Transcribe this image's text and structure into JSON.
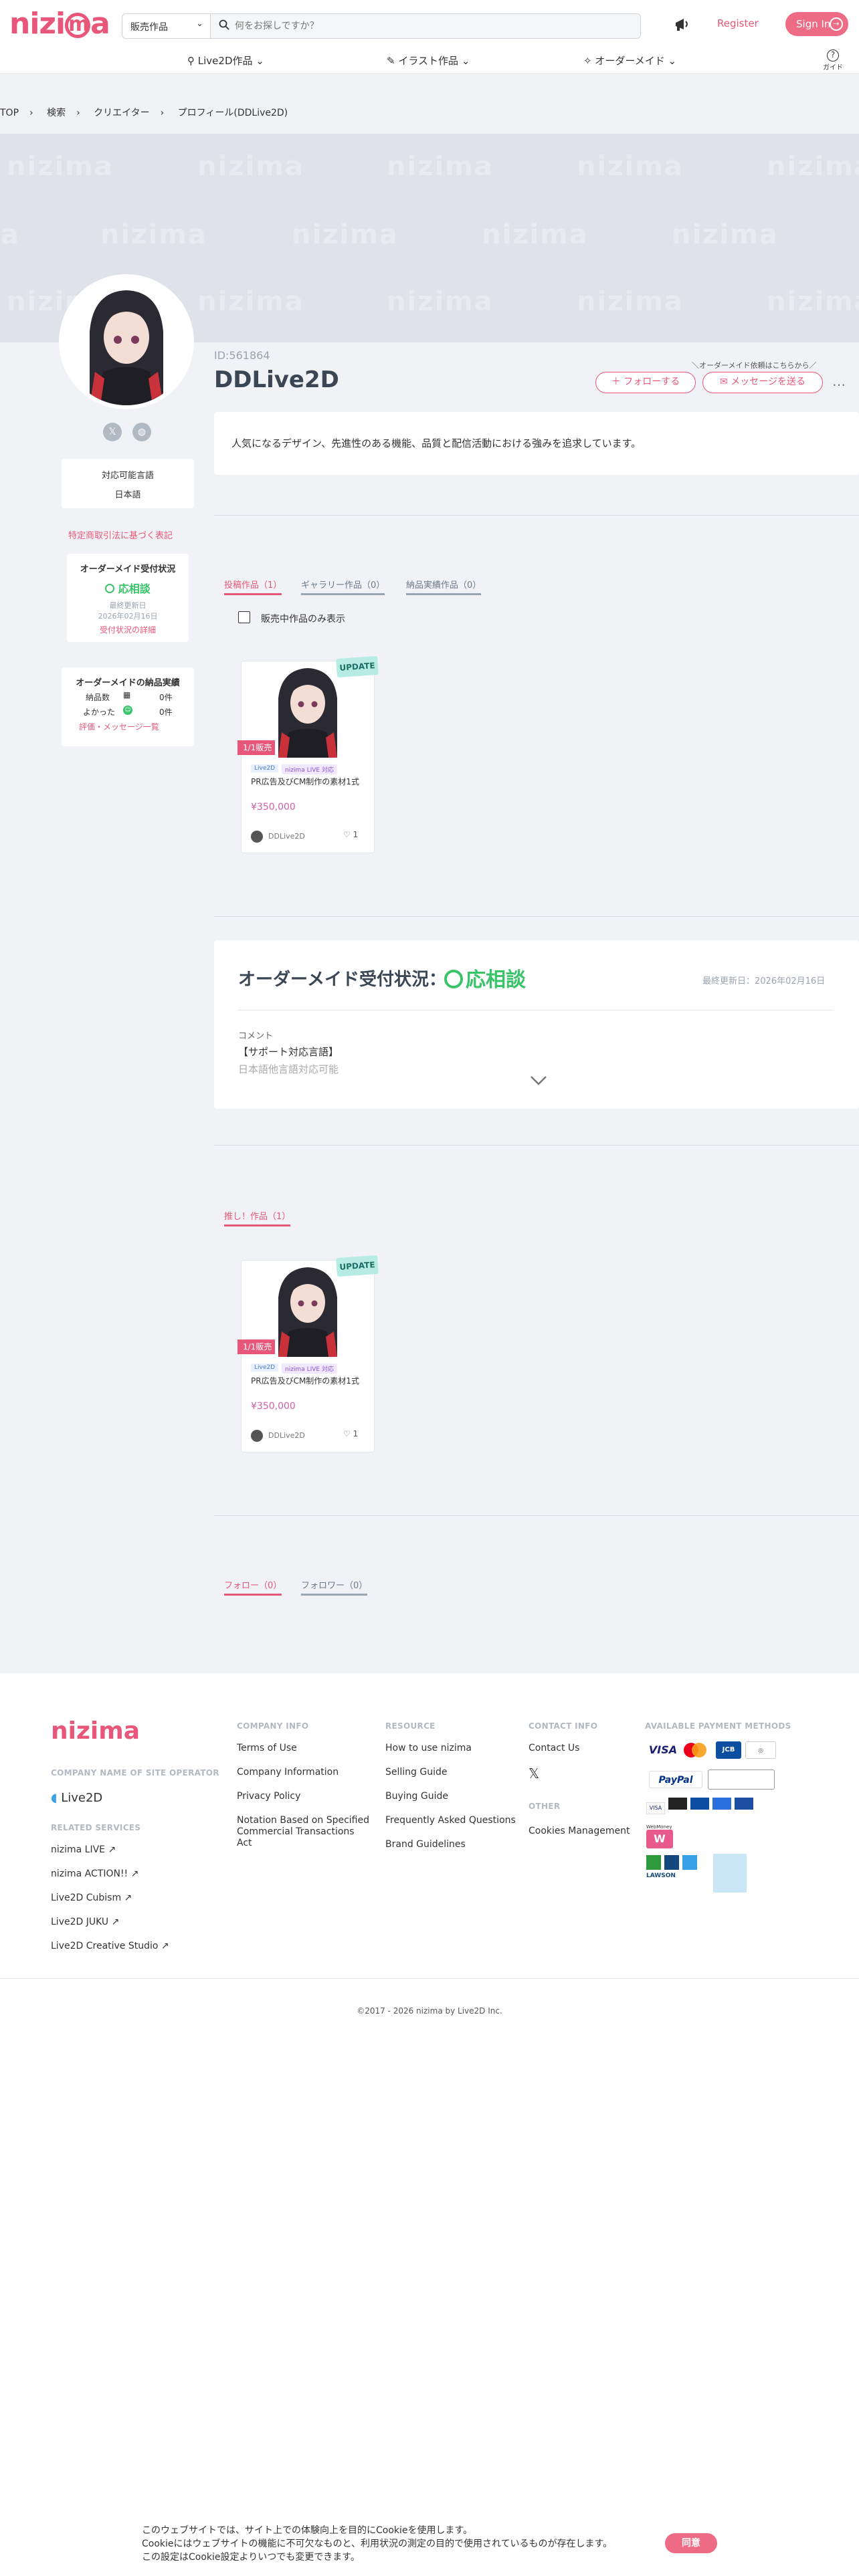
{
  "header": {
    "logo": "nizima",
    "search_category": "販売作品",
    "search_placeholder": "何をお探しですか？",
    "register": "Register",
    "sign_in": "Sign In",
    "nav": [
      "Live2D作品",
      "イラスト作品",
      "オーダーメイド"
    ],
    "guide": "ガイド"
  },
  "breadcrumb": [
    "TOP",
    "検索",
    "クリエイター",
    "プロフィール(DDLive2D)"
  ],
  "banner_watermark": "nizima",
  "profile": {
    "id": "ID:561864",
    "name": "DDLive2D",
    "order_hint": "＼オーダーメイド依頼はこちらから／",
    "follow": "フォローする",
    "message": "メッセージを送る",
    "more": "…",
    "bio": "人気になるデザイン、先進性のある機能、品質と配信活動における強みを追求しています。"
  },
  "sidebar": {
    "languages_title": "対応可能言語",
    "languages_value": "日本語",
    "legal_link": "特定商取引法に基づく表記",
    "order_status_title": "オーダーメイド受付状況",
    "order_status_value": "応相談",
    "updated_label": "最終更新日",
    "updated_date": "2026年02月16日",
    "status_detail_link": "受付状況の詳細",
    "delivery_title": "オーダーメイドの納品実績",
    "delivery_count_label": "納品数",
    "delivery_count": "0件",
    "good_label": "よかった",
    "good_count": "0件",
    "reviews_link": "評価・メッセージ一覧"
  },
  "tabs": [
    "投稿作品（1）",
    "ギャラリー作品（0）",
    "納品実績作品（0）"
  ],
  "filter_label": "販売中作品のみ表示",
  "work_card": {
    "badge": "UPDATE",
    "ribbon": "1/1販売",
    "tag1": "Live2D",
    "tag2": "nizima LIVE 対応",
    "title": "PR広告及びCM制作の素材1式",
    "price": "¥350,000",
    "author": "DDLive2D",
    "likes": "1"
  },
  "order_box": {
    "title": "オーダーメイド受付状況：",
    "status": "応相談",
    "updated": "最終更新日：2026年02月16日",
    "comment_label": "コメント",
    "comment_line1": "【サポート対応言語】",
    "comment_line2": "日本語他言語対応可能"
  },
  "recommend_tab": "推し！作品（1）",
  "follow_tabs": [
    "フォロー（0）",
    "フォロワー（0）"
  ],
  "footer": {
    "logo": "nizima",
    "operator_title": "COMPANY NAME OF SITE OPERATOR",
    "operator_name": "Live2D",
    "related_title": "RELATED SERVICES",
    "related": [
      "nizima LIVE",
      "nizima ACTION!!",
      "Live2D Cubism",
      "Live2D JUKU",
      "Live2D Creative Studio"
    ],
    "company_title": "COMPANY INFO",
    "company": [
      "Terms of Use",
      "Company Information",
      "Privacy Policy",
      "Notation Based on Specified Commercial Transactions Act"
    ],
    "resource_title": "RESOURCE",
    "resource": [
      "How to use nizima",
      "Selling Guide",
      "Buying Guide",
      "Frequently Asked Questions",
      "Brand Guidelines"
    ],
    "contact_title": "CONTACT INFO",
    "contact": "Contact Us",
    "other_title": "OTHER",
    "other": "Cookies Management",
    "payment_title": "AVAILABLE PAYMENT METHODS",
    "payments": [
      "VISA",
      "PayPal",
      "LAWSON",
      "WebMoney"
    ],
    "copyright": "©2017 - 2026 nizima by Live2D Inc."
  },
  "cookie": {
    "line1": "このウェブサイトでは、サイト上での体験向上を目的にCookieを使用します。",
    "line2": "Cookieにはウェブサイトの機能に不可欠なものと、利用状況の測定の目的で使用されているものが存在します。",
    "line3": "この設定はCookie設定よりいつでも変更できます。",
    "agree": "同意"
  }
}
